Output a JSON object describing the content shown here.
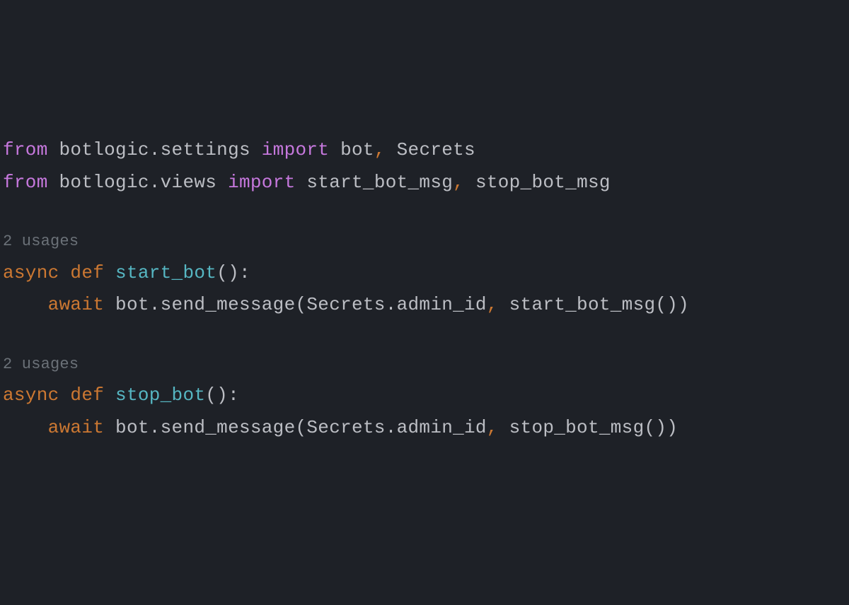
{
  "code": {
    "line1": {
      "t1": "from",
      "t2": " botlogic.settings ",
      "t3": "import",
      "t4": " bot",
      "t5": ",",
      "t6": " Secrets"
    },
    "line2": {
      "t1": "from",
      "t2": " botlogic.views ",
      "t3": "import",
      "t4": " start_bot_msg",
      "t5": ",",
      "t6": " stop_bot_msg"
    },
    "usage1": "2 usages",
    "line3": {
      "t1": "async ",
      "t2": "def ",
      "t3": "start_bot",
      "t4": "():"
    },
    "line4": {
      "t1": "    ",
      "t2": "await",
      "t3": " bot.send_message(Secrets.admin_id",
      "t4": ",",
      "t5": " start_bot_msg())"
    },
    "usage2": "2 usages",
    "line5": {
      "t1": "async ",
      "t2": "def ",
      "t3": "stop_bot",
      "t4": "():"
    },
    "line6": {
      "t1": "    ",
      "t2": "await",
      "t3": " bot.send_message(Secrets.admin_id",
      "t4": ",",
      "t5": " stop_bot_msg())"
    }
  },
  "colors": {
    "background": "#1e2127",
    "keyword_purple": "#c678dd",
    "keyword_orange": "#cc7832",
    "function_name": "#56b6c2",
    "identifier": "#bcbec4",
    "hint": "#6b7178"
  }
}
